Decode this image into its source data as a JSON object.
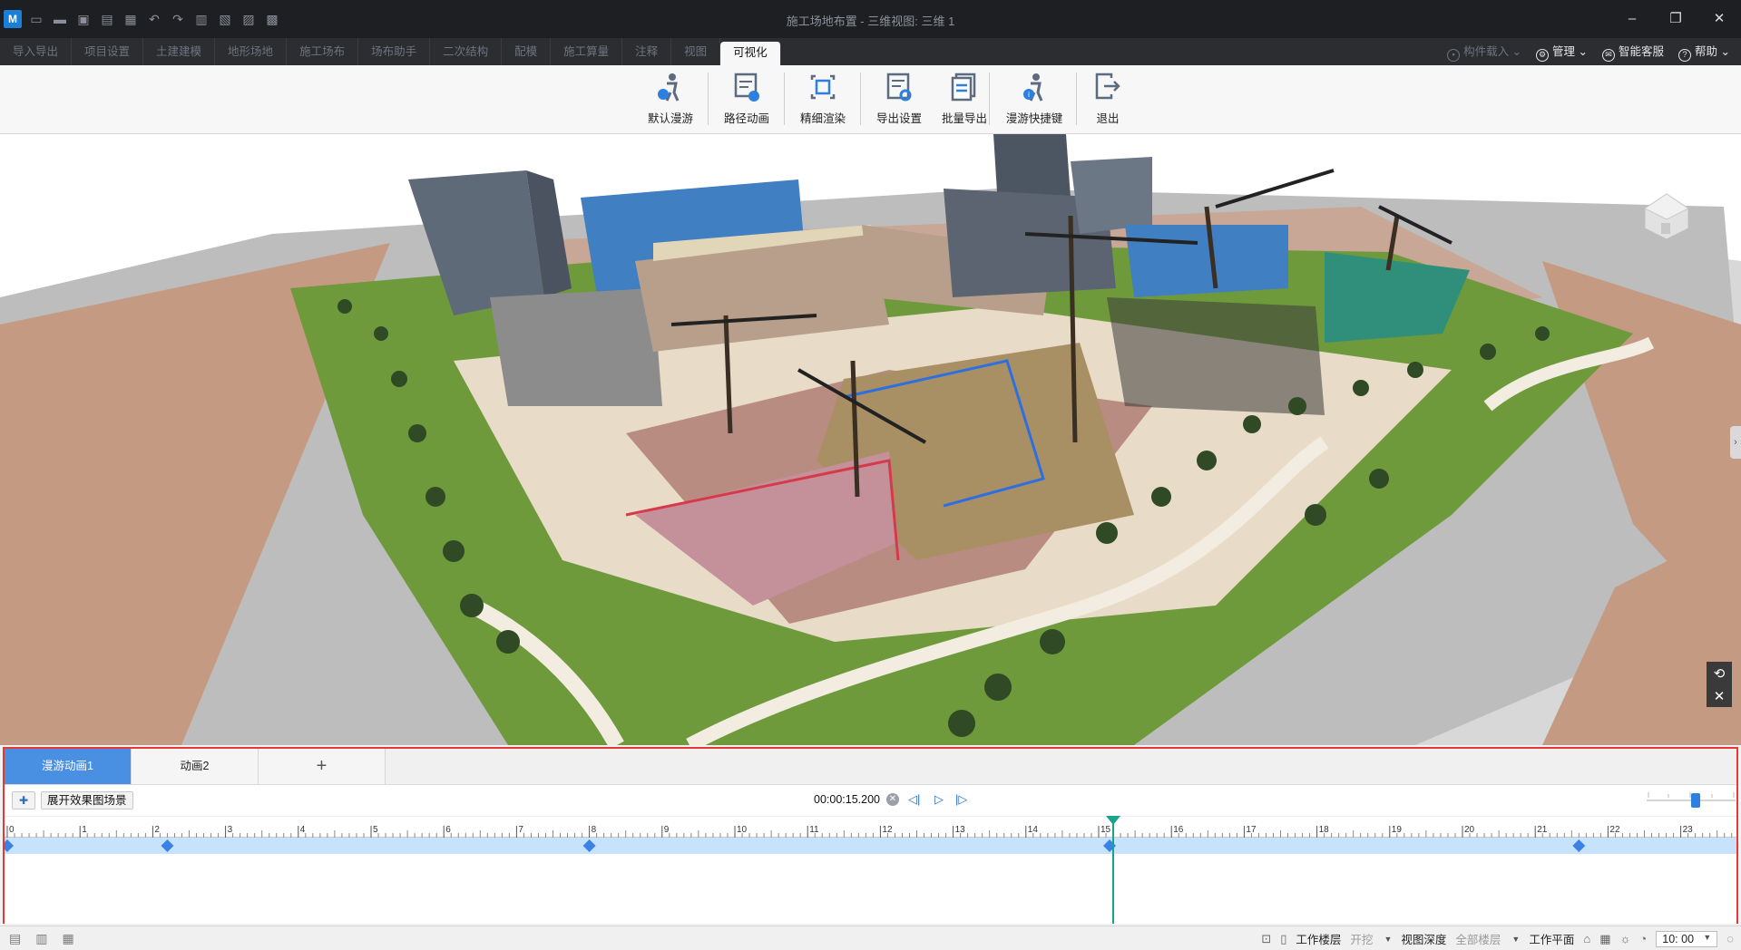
{
  "window": {
    "title": "施工场地布置 - 三维视图: 三维 1",
    "controls": [
      "–",
      "❐",
      "✕"
    ]
  },
  "menu": {
    "tabs": [
      {
        "label": "导入导出"
      },
      {
        "label": "项目设置"
      },
      {
        "label": "土建建模"
      },
      {
        "label": "地形场地"
      },
      {
        "label": "施工场布"
      },
      {
        "label": "场布助手"
      },
      {
        "label": "二次结构"
      },
      {
        "label": "配模"
      },
      {
        "label": "施工算量"
      },
      {
        "label": "注释"
      },
      {
        "label": "视图"
      },
      {
        "label": "可视化"
      }
    ],
    "active_tab": "可视化",
    "right": {
      "component_load": "构件载入",
      "manage": "管理",
      "smart_service": "智能客服",
      "help": "帮助"
    }
  },
  "ribbon": {
    "buttons": [
      {
        "label": "默认漫游",
        "icon": "walk-person-icon"
      },
      {
        "label": "路径动画",
        "icon": "path-animation-icon"
      },
      {
        "label": "精细渲染",
        "icon": "fine-render-icon"
      },
      {
        "label": "导出设置",
        "icon": "export-settings-icon"
      },
      {
        "label": "批量导出",
        "icon": "batch-export-icon"
      },
      {
        "label": "漫游快捷键",
        "icon": "roam-shortcut-icon"
      },
      {
        "label": "退出",
        "icon": "exit-icon"
      }
    ]
  },
  "animation": {
    "tabs": [
      {
        "label": "漫游动画1",
        "active": true
      },
      {
        "label": "动画2",
        "active": false
      }
    ],
    "add_tab_label": "+",
    "expand_button": "展开效果图场景",
    "current_time": "00:00:15.200",
    "clear_symbol": "✕",
    "ruler_ticks": [
      "0",
      "1",
      "2",
      "3",
      "4",
      "5",
      "6",
      "7",
      "8",
      "9",
      "10",
      "11",
      "12",
      "13",
      "14",
      "15",
      "16",
      "17",
      "18",
      "19",
      "20",
      "21",
      "22",
      "23"
    ],
    "keyframes": [
      0,
      2.2,
      8,
      15.15,
      21.6
    ],
    "playhead_seconds": 15.2,
    "zoom_level": 0.55
  },
  "status": {
    "work_floor_label": "工作楼层",
    "work_floor_value": "开挖",
    "view_depth_label": "视图深度",
    "view_depth_value": "全部楼层",
    "work_plane_label": "工作平面",
    "time_value": "10: 00"
  },
  "colors": {
    "accent_blue": "#4a90e2",
    "panel_border": "#e53935",
    "playhead": "#1aa38c",
    "keyframe": "#3b82e6",
    "track": "#c6e3fb"
  }
}
